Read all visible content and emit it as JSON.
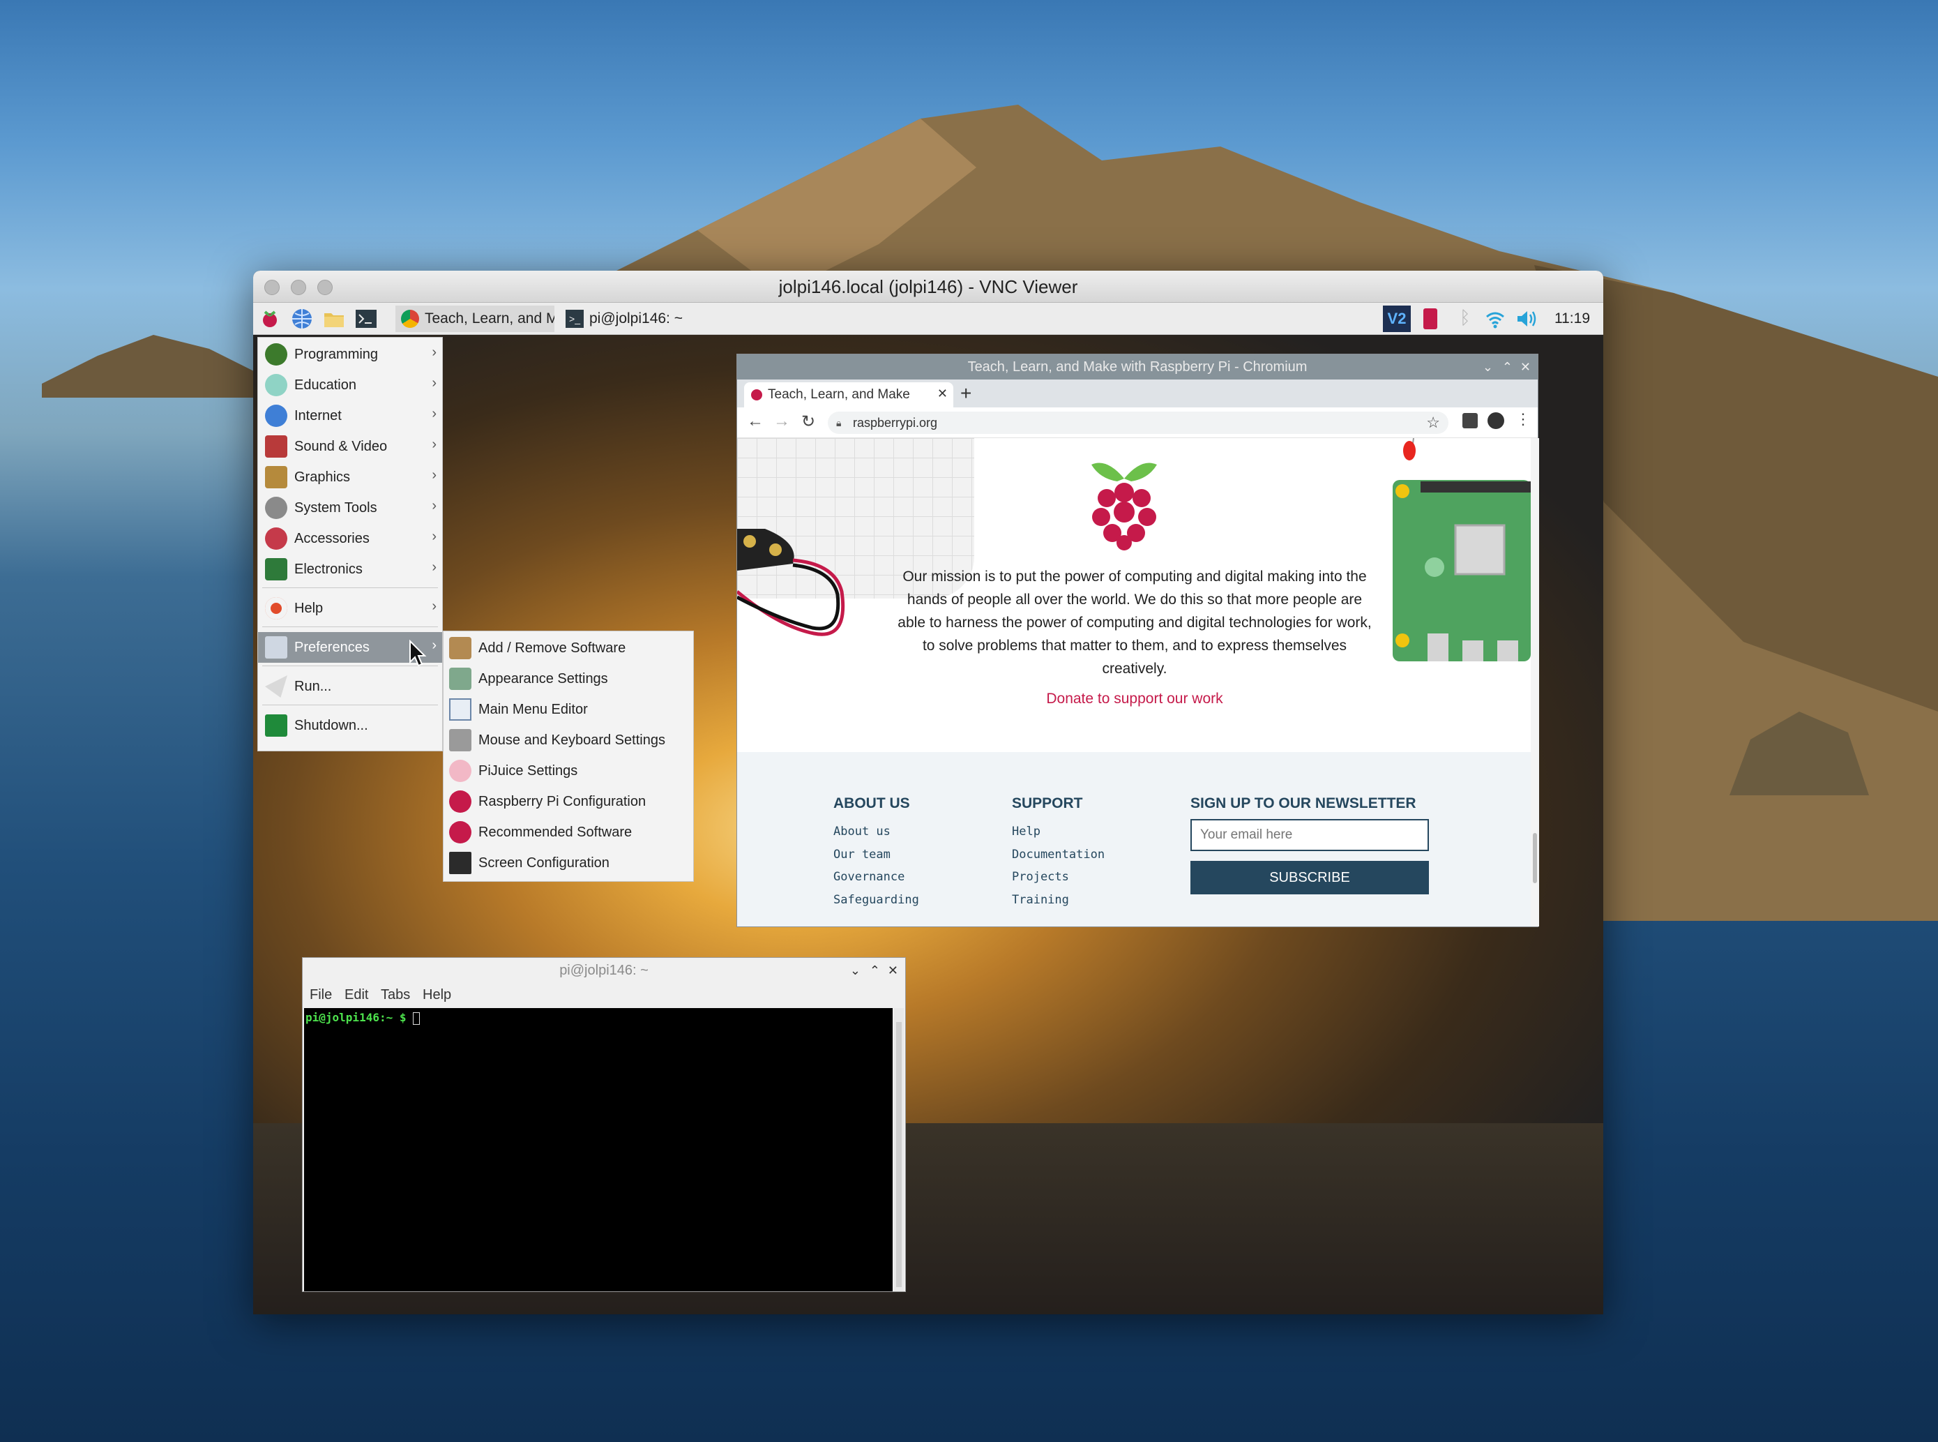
{
  "vnc": {
    "title": "jolpi146.local (jolpi146) - VNC Viewer"
  },
  "taskbar": {
    "tasks": [
      {
        "label": "Teach, Learn, and Ma..."
      },
      {
        "label": "pi@jolpi146: ~"
      }
    ],
    "tray": {
      "vnc_label": "V2",
      "clock": "11:19"
    }
  },
  "menu": {
    "items": [
      {
        "label": "Programming",
        "icon": "programming-icon"
      },
      {
        "label": "Education",
        "icon": "education-icon"
      },
      {
        "label": "Internet",
        "icon": "internet-icon"
      },
      {
        "label": "Sound & Video",
        "icon": "sound-video-icon"
      },
      {
        "label": "Graphics",
        "icon": "graphics-icon"
      },
      {
        "label": "System Tools",
        "icon": "system-tools-icon"
      },
      {
        "label": "Accessories",
        "icon": "accessories-icon"
      },
      {
        "label": "Electronics",
        "icon": "electronics-icon"
      },
      {
        "label": "Help",
        "icon": "help-icon"
      },
      {
        "label": "Preferences",
        "icon": "preferences-icon"
      },
      {
        "label": "Run...",
        "icon": "run-icon"
      },
      {
        "label": "Shutdown...",
        "icon": "shutdown-icon"
      }
    ],
    "submenu": [
      {
        "label": "Add / Remove Software"
      },
      {
        "label": "Appearance Settings"
      },
      {
        "label": "Main Menu Editor"
      },
      {
        "label": "Mouse and Keyboard Settings"
      },
      {
        "label": "PiJuice Settings"
      },
      {
        "label": "Raspberry Pi Configuration"
      },
      {
        "label": "Recommended Software"
      },
      {
        "label": "Screen Configuration"
      }
    ]
  },
  "chromium": {
    "title": "Teach, Learn, and Make with Raspberry Pi - Chromium",
    "tab_label": "Teach, Learn, and Make",
    "url": "raspberrypi.org",
    "mission": "Our mission is to put the power of computing and digital making into the hands of people all over the world. We do this so that more people are able to harness the power of computing and digital technologies for work, to solve problems that matter to them, and to express themselves creatively.",
    "donate": "Donate to support our work",
    "footer": {
      "about": {
        "heading": "ABOUT US",
        "links": [
          "About us",
          "Our team",
          "Governance",
          "Safeguarding"
        ]
      },
      "support": {
        "heading": "SUPPORT",
        "links": [
          "Help",
          "Documentation",
          "Projects",
          "Training"
        ]
      },
      "newsletter": {
        "heading": "SIGN UP TO OUR NEWSLETTER",
        "placeholder": "Your email here",
        "button": "SUBSCRIBE"
      }
    }
  },
  "terminal": {
    "title": "pi@jolpi146: ~",
    "menu": [
      "File",
      "Edit",
      "Tabs",
      "Help"
    ],
    "prompt_user": "pi@jolpi146:~ $"
  },
  "colors": {
    "accent_red": "#c51a4a",
    "footer_navy": "#25475e",
    "terminal_green": "#4de34d"
  }
}
